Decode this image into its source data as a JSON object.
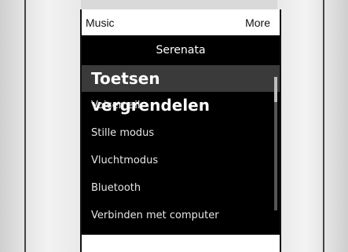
{
  "softkeys": {
    "left_label": "Music",
    "right_label": "More"
  },
  "menu": {
    "title": "Serenata",
    "items": [
      {
        "label": "Toetsen vergrendelen",
        "selected": true
      },
      {
        "label": "Voicemail",
        "selected": false
      },
      {
        "label": "Stille modus",
        "selected": false
      },
      {
        "label": "Vluchtmodus",
        "selected": false
      },
      {
        "label": "Bluetooth",
        "selected": false
      },
      {
        "label": "Verbinden met computer",
        "selected": false
      }
    ]
  },
  "colors": {
    "screen_bg": "#000000",
    "selection_bg": "#3a3a3a",
    "softkey_bg": "#ffffff"
  }
}
